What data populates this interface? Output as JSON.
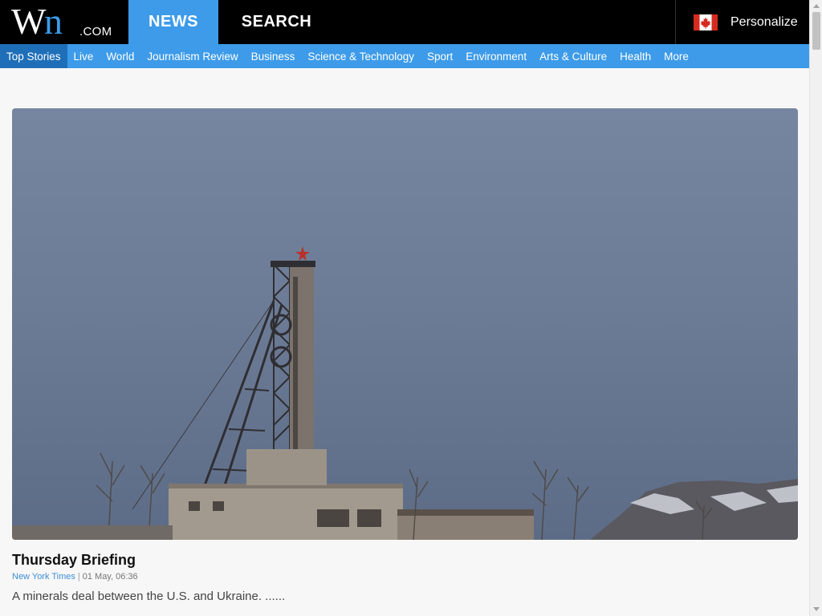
{
  "header": {
    "logo_w": "W",
    "logo_n": "n",
    "logo_com": ".COM",
    "tabs": [
      {
        "label": "NEWS",
        "active": true
      },
      {
        "label": "SEARCH",
        "active": false
      }
    ],
    "personalize_label": "Personalize",
    "flag_icon": "canada-flag-icon"
  },
  "nav": {
    "items": [
      {
        "label": "Top Stories",
        "active": true
      },
      {
        "label": "Live"
      },
      {
        "label": "World"
      },
      {
        "label": "Journalism Review"
      },
      {
        "label": "Business"
      },
      {
        "label": "Science & Technology"
      },
      {
        "label": "Sport"
      },
      {
        "label": "Environment"
      },
      {
        "label": "Arts & Culture"
      },
      {
        "label": "Health"
      },
      {
        "label": "More"
      }
    ]
  },
  "article": {
    "headline": "Thursday Briefing",
    "source": "New York Times",
    "separator": "|",
    "timestamp": "01 May, 06:36",
    "summary": "A minerals deal between the U.S. and Ukraine. ......"
  },
  "colors": {
    "accent": "#3d9be9",
    "topbar": "#000000",
    "nav_active": "#1f6fb8",
    "page_bg": "#f7f7f7"
  }
}
